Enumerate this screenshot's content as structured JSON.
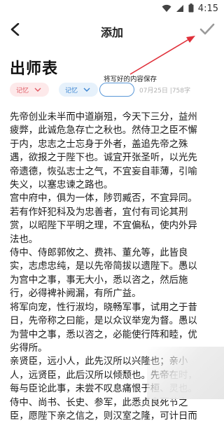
{
  "status": {
    "time": "4:15"
  },
  "appbar": {
    "title": "添加"
  },
  "document": {
    "title": "出师表",
    "tags": [
      {
        "label": "记忆"
      },
      {
        "label": "记忆"
      }
    ],
    "date": "07月25日",
    "char_count": "758字",
    "lines": [
      "先帝创业未半而中道崩殂，今天下三分，益州",
      "疲弊，此诚危急存亡之秋也。然侍卫之臣不懈",
      "于内，忠志之士忘身于外者，盖追先帝之殊",
      "遇，欲报之于陛下也。诚宜开张圣听，以光先",
      "帝遗德，恢弘志士之气，不宜妄自菲薄，引喻",
      "失义，以塞忠谏之路也。",
      "宫中府中，俱为一体，陟罚臧否，不宜异同。",
      "若有作奸犯科及为忠善者，宜付有司论其刑",
      "赏，以昭陛下平明之理，不宜偏私，使内外异",
      "法也。",
      "侍中、侍郎郭攸之、费祎、董允等，此皆良",
      "实，志虑忠纯，是以先帝简拔以遗陛下。愚以",
      "为宫中之事，事无大小，悉以咨之，然后施",
      "行，必得裨补阙漏，有所广益。",
      "将军向宠，性行淑均，晓畅军事，试用之于昔",
      "日，先帝称之曰能，是以众议举宠为督。愚以",
      "为营中之事，悉以咨之，必能使行阵和睦，优",
      "劣得所。",
      "亲贤臣，远小人，此先汉所以兴隆也；亲小",
      "人，远贤臣，此后汉所以倾颓也。先帝在时，",
      "每与臣论此事，未尝不叹息痛恨于桓、灵也。",
      "侍中、尚书、长史、参军，此悉贞良死节之",
      "臣，愿陛下亲之信之，则汉室之隆，可计日而"
    ]
  },
  "annotation": {
    "text": "将写好的内容保存"
  },
  "colors": {
    "tag_red": "#e05862",
    "tag_blue": "#3a83d1",
    "annotation_arrow": "#e0303a",
    "check_icon": "#9a9a9a"
  },
  "icons": {
    "back": "arrow-left-icon",
    "check": "check-icon",
    "wifi": "wifi-icon",
    "signal": "signal-icon",
    "battery": "battery-icon"
  }
}
